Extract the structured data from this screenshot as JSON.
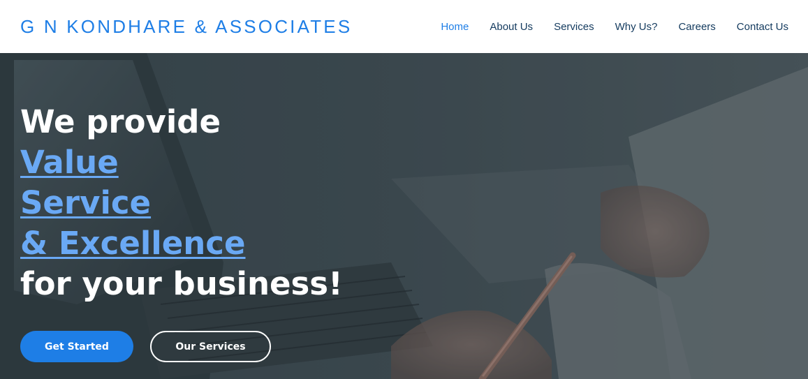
{
  "header": {
    "brand": "G N KONDHARE & ASSOCIATES",
    "nav": [
      {
        "label": "Home",
        "active": true
      },
      {
        "label": "About Us"
      },
      {
        "label": "Services"
      },
      {
        "label": "Why Us?"
      },
      {
        "label": "Careers"
      },
      {
        "label": "Contact Us"
      }
    ]
  },
  "hero": {
    "line1": "We provide",
    "accent1": "Value",
    "accent2": "Service",
    "accent3": "& Excellence",
    "line5": "for your business!",
    "primary_button": "Get Started",
    "secondary_button": "Our Services"
  },
  "colors": {
    "brand": "#1e7ee6",
    "nav_text": "#133a5e",
    "accent_text": "#6aa9f5",
    "hero_overlay": "#3d4850"
  }
}
